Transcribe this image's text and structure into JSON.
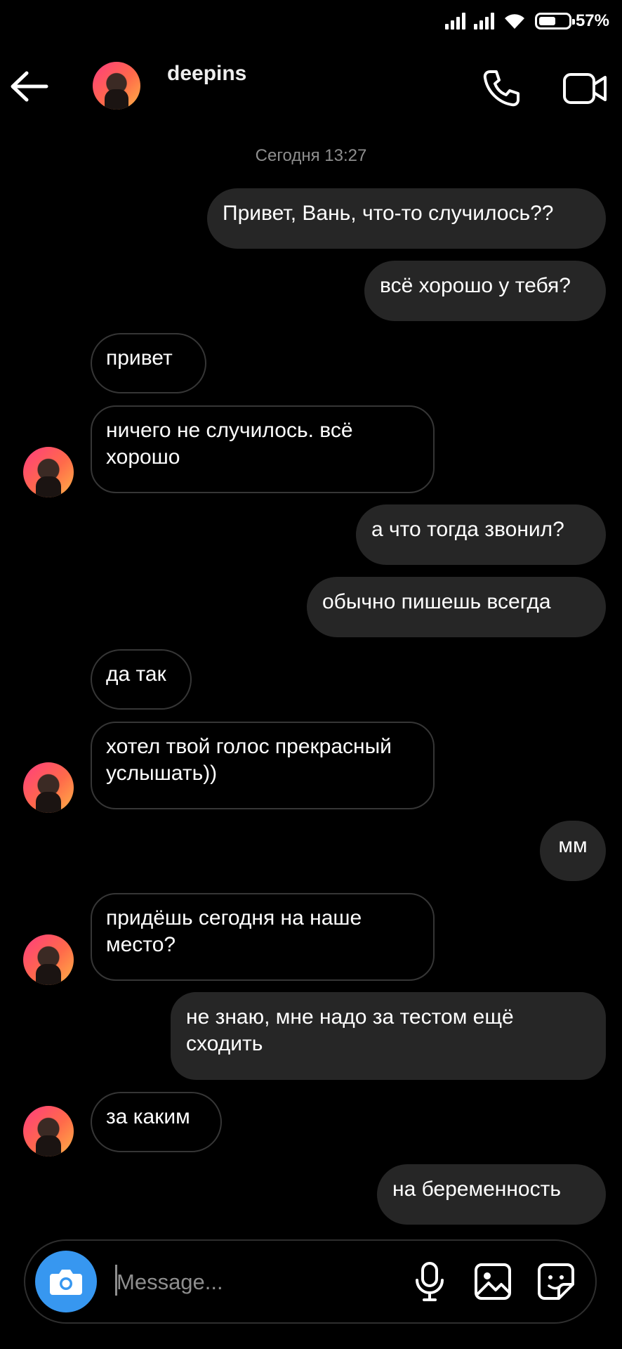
{
  "status_bar": {
    "battery": "57%",
    "battery_level": 0.57
  },
  "header": {
    "name": "deepins"
  },
  "conversation": {
    "timestamp": "Сегодня 13:27",
    "messages": [
      {
        "from": "me",
        "text": "Привет, Вань, что-то случилось??"
      },
      {
        "from": "me",
        "text": "всё хорошо у тебя?"
      },
      {
        "from": "them",
        "text": "привет"
      },
      {
        "from": "them",
        "text": "ничего не случилось. всё хорошо"
      },
      {
        "from": "me",
        "text": "а что тогда звонил?"
      },
      {
        "from": "me",
        "text": "обычно пишешь всегда"
      },
      {
        "from": "them",
        "text": "да так"
      },
      {
        "from": "them",
        "text": "хотел твой голос прекрасный услышать))"
      },
      {
        "from": "me",
        "text": "мм"
      },
      {
        "from": "them",
        "text": "придёшь сегодня на наше место?"
      },
      {
        "from": "me",
        "text": "не знаю, мне надо за тестом ещё сходить"
      },
      {
        "from": "them",
        "text": "за каким"
      },
      {
        "from": "me",
        "text": "на беременность"
      }
    ]
  },
  "composer": {
    "placeholder": "Message..."
  }
}
